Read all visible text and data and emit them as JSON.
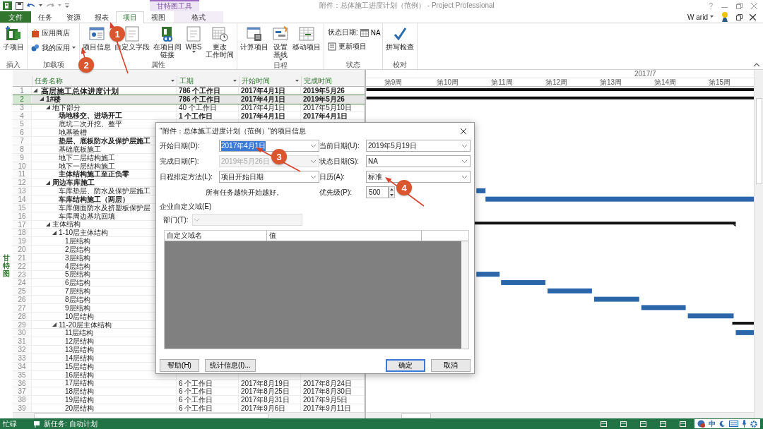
{
  "window": {
    "title": "附件：总体施工进度计划（范例） - Project Professional",
    "contextual_tab_group": "甘特图工具",
    "help_label": "?",
    "user": "W arid"
  },
  "tabs": [
    {
      "label": "文件",
      "kind": "file",
      "selected": false
    },
    {
      "label": "任务",
      "kind": "normal",
      "selected": false
    },
    {
      "label": "资源",
      "kind": "normal",
      "selected": false
    },
    {
      "label": "报表",
      "kind": "normal",
      "selected": false
    },
    {
      "label": "项目",
      "kind": "normal",
      "selected": true
    },
    {
      "label": "视图",
      "kind": "normal",
      "selected": false
    },
    {
      "label": "格式",
      "kind": "contextual",
      "selected": false
    }
  ],
  "ribbon_groups": [
    {
      "label": "插入",
      "commands": [
        {
          "label": "子项目",
          "kind": "large",
          "dropdown": false
        }
      ]
    },
    {
      "label": "加载项",
      "commands": [
        {
          "label": "应用商店",
          "kind": "small",
          "dropdown": false
        },
        {
          "label": "我的应用",
          "kind": "small",
          "dropdown": true
        }
      ]
    },
    {
      "label": "属性",
      "commands": [
        {
          "label": "项目信息",
          "kind": "large",
          "dropdown": false
        },
        {
          "label": "自定义字段",
          "kind": "large",
          "dropdown": false
        },
        {
          "lines": [
            "在项目间",
            "链接"
          ],
          "kind": "large",
          "dropdown": false
        },
        {
          "label": "WBS",
          "kind": "large",
          "dropdown": true
        },
        {
          "lines": [
            "更改",
            "工作时间"
          ],
          "kind": "large",
          "dropdown": false
        }
      ]
    },
    {
      "label": "日程",
      "commands": [
        {
          "label": "计算项目",
          "kind": "large",
          "dropdown": false
        },
        {
          "lines": [
            "设置",
            "基线"
          ],
          "kind": "large",
          "dropdown": true
        },
        {
          "label": "移动项目",
          "kind": "large",
          "dropdown": false
        }
      ]
    },
    {
      "label": "状态",
      "commands": [
        {
          "label": "状态日期:",
          "value": "NA",
          "kind": "status",
          "dropdown": false
        },
        {
          "label": "更新项目",
          "kind": "small",
          "dropdown": false
        }
      ]
    },
    {
      "label": "校对",
      "commands": [
        {
          "label": "拼写检查",
          "kind": "large",
          "dropdown": false
        }
      ]
    }
  ],
  "view_label": "甘特图",
  "table": {
    "columns": [
      {
        "label": "任务名称",
        "filter": true
      },
      {
        "label": "工期",
        "filter": true
      },
      {
        "label": "开始时间",
        "filter": true
      },
      {
        "label": "完成时间",
        "filter": false
      }
    ],
    "rows": [
      {
        "id": "1",
        "name": "高层施工总体进度计划",
        "bold": true,
        "selected": false,
        "expanded": true,
        "duration": "786 个工作日",
        "start": "2017年4月1日",
        "finish": "2019年5月26",
        "children": [
          {
            "id": "2",
            "name": "1#楼",
            "bold": true,
            "selected": true,
            "expanded": true,
            "duration": "786 个工作日",
            "start": "2017年4月1日",
            "finish": "2019年5月26",
            "children": [
              {
                "id": "3",
                "name": "地下部分",
                "bold": false,
                "selected": false,
                "expanded": true,
                "duration": "40 个工作日",
                "start": "2017年4月1日",
                "finish": "2017年5月10日",
                "children": [
                  {
                    "id": "4",
                    "name": "场地移交、进场开工",
                    "bold": true,
                    "selected": false,
                    "duration": "1 个工作日",
                    "start": "2017年4月1日",
                    "finish": "2017年4月1日"
                  },
                  {
                    "id": "5",
                    "name": "底坑二次开挖、整平",
                    "bold": false,
                    "selected": false
                  },
                  {
                    "id": "6",
                    "name": "地基验槽",
                    "bold": false,
                    "selected": false
                  },
                  {
                    "id": "7",
                    "name": "垫层、底板防水及保护层施工",
                    "bold": true,
                    "selected": false
                  },
                  {
                    "id": "8",
                    "name": "基础底板施工",
                    "bold": false,
                    "selected": false
                  },
                  {
                    "id": "9",
                    "name": "地下二层结构施工",
                    "bold": false,
                    "selected": false
                  },
                  {
                    "id": "10",
                    "name": "地下一层结构施工",
                    "bold": false,
                    "selected": false
                  },
                  {
                    "id": "11",
                    "name": "主体结构施工至正负零",
                    "bold": true,
                    "selected": false
                  }
                ]
              },
              {
                "id": "12",
                "name": "周边车库施工",
                "bold": true,
                "selected": false,
                "expanded": true,
                "children": [
                  {
                    "id": "13",
                    "name": "车库垫层、防水及保护层施工",
                    "bold": false,
                    "selected": false
                  },
                  {
                    "id": "14",
                    "name": "车库结构施工（两层）",
                    "bold": true,
                    "selected": false
                  },
                  {
                    "id": "15",
                    "name": "车库侧面防水及挤塑板保护层",
                    "bold": false,
                    "selected": false
                  },
                  {
                    "id": "16",
                    "name": "车库周边基坑回填",
                    "bold": false,
                    "selected": false
                  }
                ]
              },
              {
                "id": "17",
                "name": "主体结构",
                "bold": false,
                "selected": false,
                "expanded": true,
                "children": [
                  {
                    "id": "18",
                    "name": "1-10层主体结构",
                    "bold": false,
                    "selected": false,
                    "expanded": true,
                    "children": [
                      {
                        "id": "19",
                        "name": "1层结构",
                        "bold": false,
                        "selected": false
                      },
                      {
                        "id": "20",
                        "name": "2层结构",
                        "bold": false,
                        "selected": false
                      },
                      {
                        "id": "21",
                        "name": "3层结构",
                        "bold": false,
                        "selected": false
                      },
                      {
                        "id": "22",
                        "name": "4层结构",
                        "bold": false,
                        "selected": false
                      },
                      {
                        "id": "23",
                        "name": "5层结构",
                        "bold": false,
                        "selected": false
                      },
                      {
                        "id": "24",
                        "name": "6层结构",
                        "bold": false,
                        "selected": false
                      },
                      {
                        "id": "25",
                        "name": "7层结构",
                        "bold": false,
                        "selected": false
                      },
                      {
                        "id": "26",
                        "name": "8层结构",
                        "bold": false,
                        "selected": false
                      },
                      {
                        "id": "27",
                        "name": "9层结构",
                        "bold": false,
                        "selected": false
                      },
                      {
                        "id": "28",
                        "name": "10层结构",
                        "bold": false,
                        "selected": false
                      }
                    ]
                  },
                  {
                    "id": "29",
                    "name": "11-20层主体结构",
                    "bold": false,
                    "selected": false,
                    "expanded": true,
                    "children": [
                      {
                        "id": "30",
                        "name": "11层结构",
                        "bold": false,
                        "selected": false
                      },
                      {
                        "id": "31",
                        "name": "12层结构",
                        "bold": false,
                        "selected": false
                      },
                      {
                        "id": "32",
                        "name": "13层结构",
                        "bold": false,
                        "selected": false
                      },
                      {
                        "id": "33",
                        "name": "14层结构",
                        "bold": false,
                        "selected": false
                      },
                      {
                        "id": "34",
                        "name": "15层结构",
                        "bold": false,
                        "selected": false
                      },
                      {
                        "id": "35",
                        "name": "16层结构",
                        "bold": false,
                        "selected": false
                      },
                      {
                        "id": "36",
                        "name": "17层结构",
                        "bold": false,
                        "selected": false,
                        "duration": "6 个工作日",
                        "start": "2017年8月19日",
                        "finish": "2017年8月24日"
                      },
                      {
                        "id": "37",
                        "name": "18层结构",
                        "bold": false,
                        "selected": false,
                        "duration": "6 个工作日",
                        "start": "2017年8月25日",
                        "finish": "2017年8月30日"
                      },
                      {
                        "id": "38",
                        "name": "19层结构",
                        "bold": false,
                        "selected": false,
                        "duration": "6 个工作日",
                        "start": "2017年8月31日",
                        "finish": "2017年9月5日"
                      },
                      {
                        "id": "39",
                        "name": "20层结构",
                        "bold": false,
                        "selected": false,
                        "duration": "6 个工作日",
                        "start": "2017年9月6日",
                        "finish": "2017年9月11日"
                      }
                    ]
                  }
                ]
              }
            ]
          }
        ]
      }
    ]
  },
  "timescale": {
    "month": "2017/7",
    "weeks": [
      "第9周",
      "第10周",
      "第11周",
      "第12周",
      "第13周",
      "第14周",
      "第15周"
    ]
  },
  "dialog": {
    "title": "\"附件：总体施工进度计划（范例）\"的项目信息",
    "fields": [
      {
        "kind": "dropdown",
        "label": "开始日期(D):",
        "value": "2017年4月1日",
        "disabled": false,
        "text_selected": true
      },
      {
        "kind": "dropdown",
        "label": "当前日期(U):",
        "value": "2019年5月19日",
        "disabled": false,
        "text_selected": false
      },
      {
        "kind": "dropdown",
        "label": "完成日期(F):",
        "value": "2019年5月26日",
        "disabled": true,
        "text_selected": false
      },
      {
        "kind": "dropdown",
        "label": "状态日期(S):",
        "value": "NA",
        "disabled": false,
        "text_selected": false
      },
      {
        "kind": "dropdown",
        "label": "日程排定方法(L):",
        "value": "项目开始日期",
        "disabled": false,
        "text_selected": false
      },
      {
        "kind": "dropdown",
        "label": "日历(A):",
        "value": "标准",
        "disabled": false,
        "text_selected": false
      },
      {
        "kind": "note",
        "label": "所有任务越快开始越好。"
      },
      {
        "kind": "spinner",
        "label": "优先级(P):",
        "value": "500",
        "disabled": false,
        "text_selected": false
      }
    ],
    "section_label": "企业自定义域(E)",
    "department": {
      "label": "部门(T):",
      "disabled": true
    },
    "grid_columns": [
      "自定义域名",
      "值"
    ],
    "buttons_left": [
      {
        "label": "帮助(H)",
        "default": false
      },
      {
        "label": "统计信息(I)...",
        "default": false
      }
    ],
    "buttons_right": [
      {
        "label": "确定",
        "default": true
      },
      {
        "label": "取消",
        "default": false
      }
    ]
  },
  "annotations": [
    {
      "label": "1"
    },
    {
      "label": "2"
    },
    {
      "label": "3"
    },
    {
      "label": "4"
    }
  ],
  "status_bar": {
    "state": "忙碌",
    "new_task_mode": "新任务: 自动计划",
    "ime": "中"
  }
}
